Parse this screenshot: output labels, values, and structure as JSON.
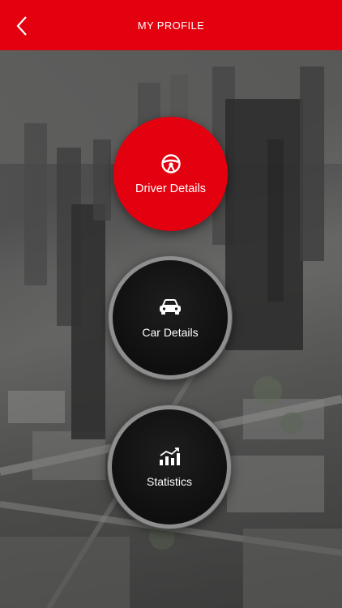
{
  "header": {
    "title": "MY PROFILE",
    "back_icon": "chevron-left-icon",
    "background": "#e3000f"
  },
  "menu": [
    {
      "id": "driver",
      "label": "Driver Details",
      "icon": "steering-wheel-icon",
      "active": true
    },
    {
      "id": "car",
      "label": "Car Details",
      "icon": "car-icon",
      "active": false
    },
    {
      "id": "stats",
      "label": "Statistics",
      "icon": "bar-chart-icon",
      "active": false
    }
  ],
  "colors": {
    "accent": "#e3000f",
    "dark_button": "#111111",
    "ring": "#8e8e8e"
  }
}
